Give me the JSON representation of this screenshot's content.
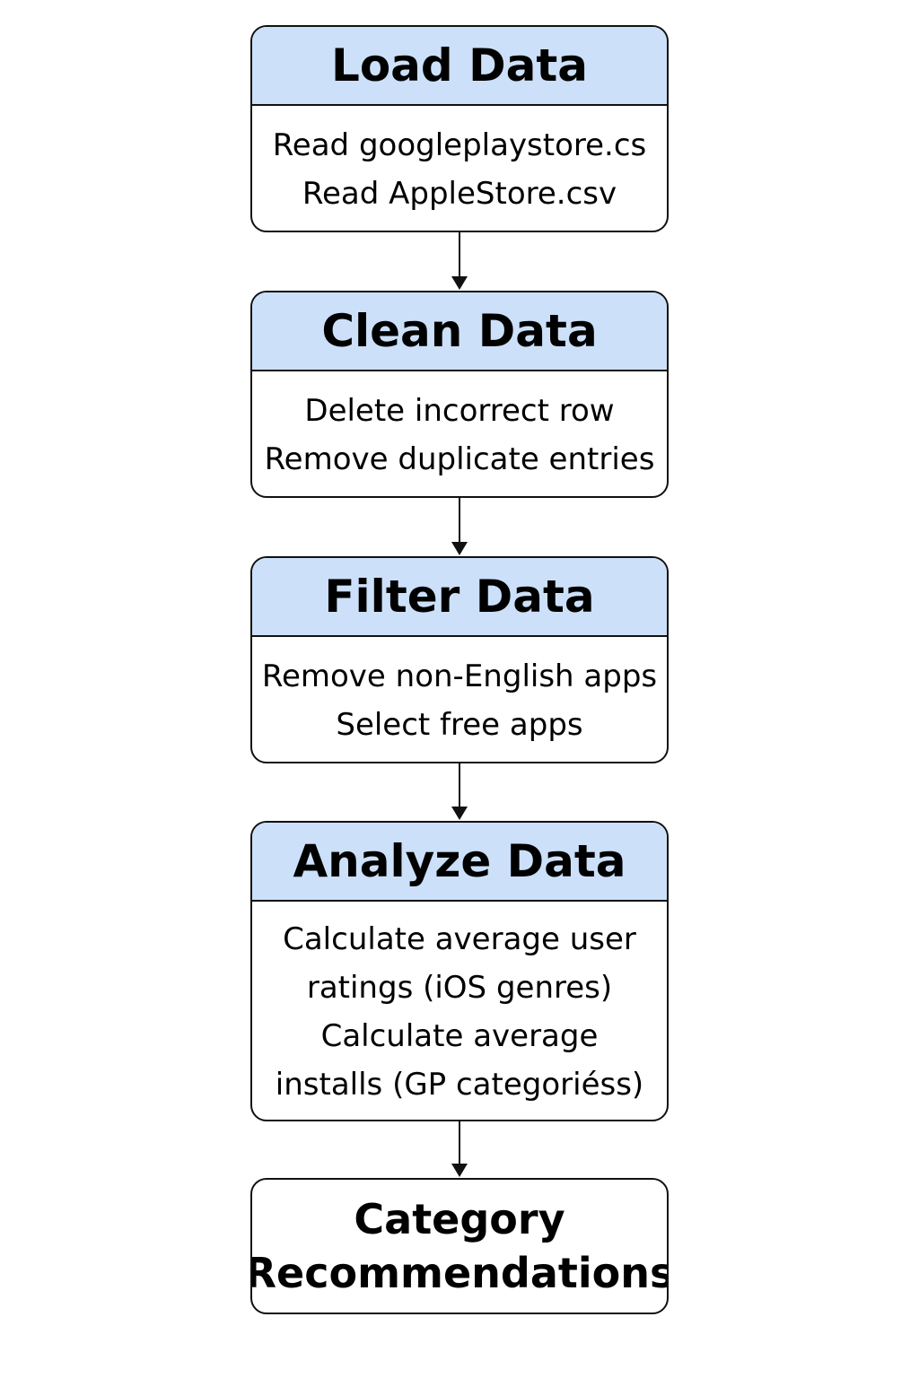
{
  "colors": {
    "header_fill": "#cce0f9",
    "border": "#111111",
    "arrow": "#111111"
  },
  "steps": [
    {
      "title": "Load Data",
      "lines": [
        "Read googleplaystore.cs",
        "Read AppleStore.csv"
      ]
    },
    {
      "title": "Clean Data",
      "lines": [
        "Delete incorrect row",
        "Remove duplicate entries"
      ]
    },
    {
      "title": "Filter Data",
      "lines": [
        "Remove non-English apps",
        "Select free apps"
      ]
    },
    {
      "title": "Analyze Data",
      "lines": [
        "Calculate average user",
        "ratings (iOS genres)",
        "Calculate average",
        "installs (GP categoriéss)"
      ]
    }
  ],
  "final": {
    "lines": [
      "Category",
      "Recommendations"
    ]
  }
}
